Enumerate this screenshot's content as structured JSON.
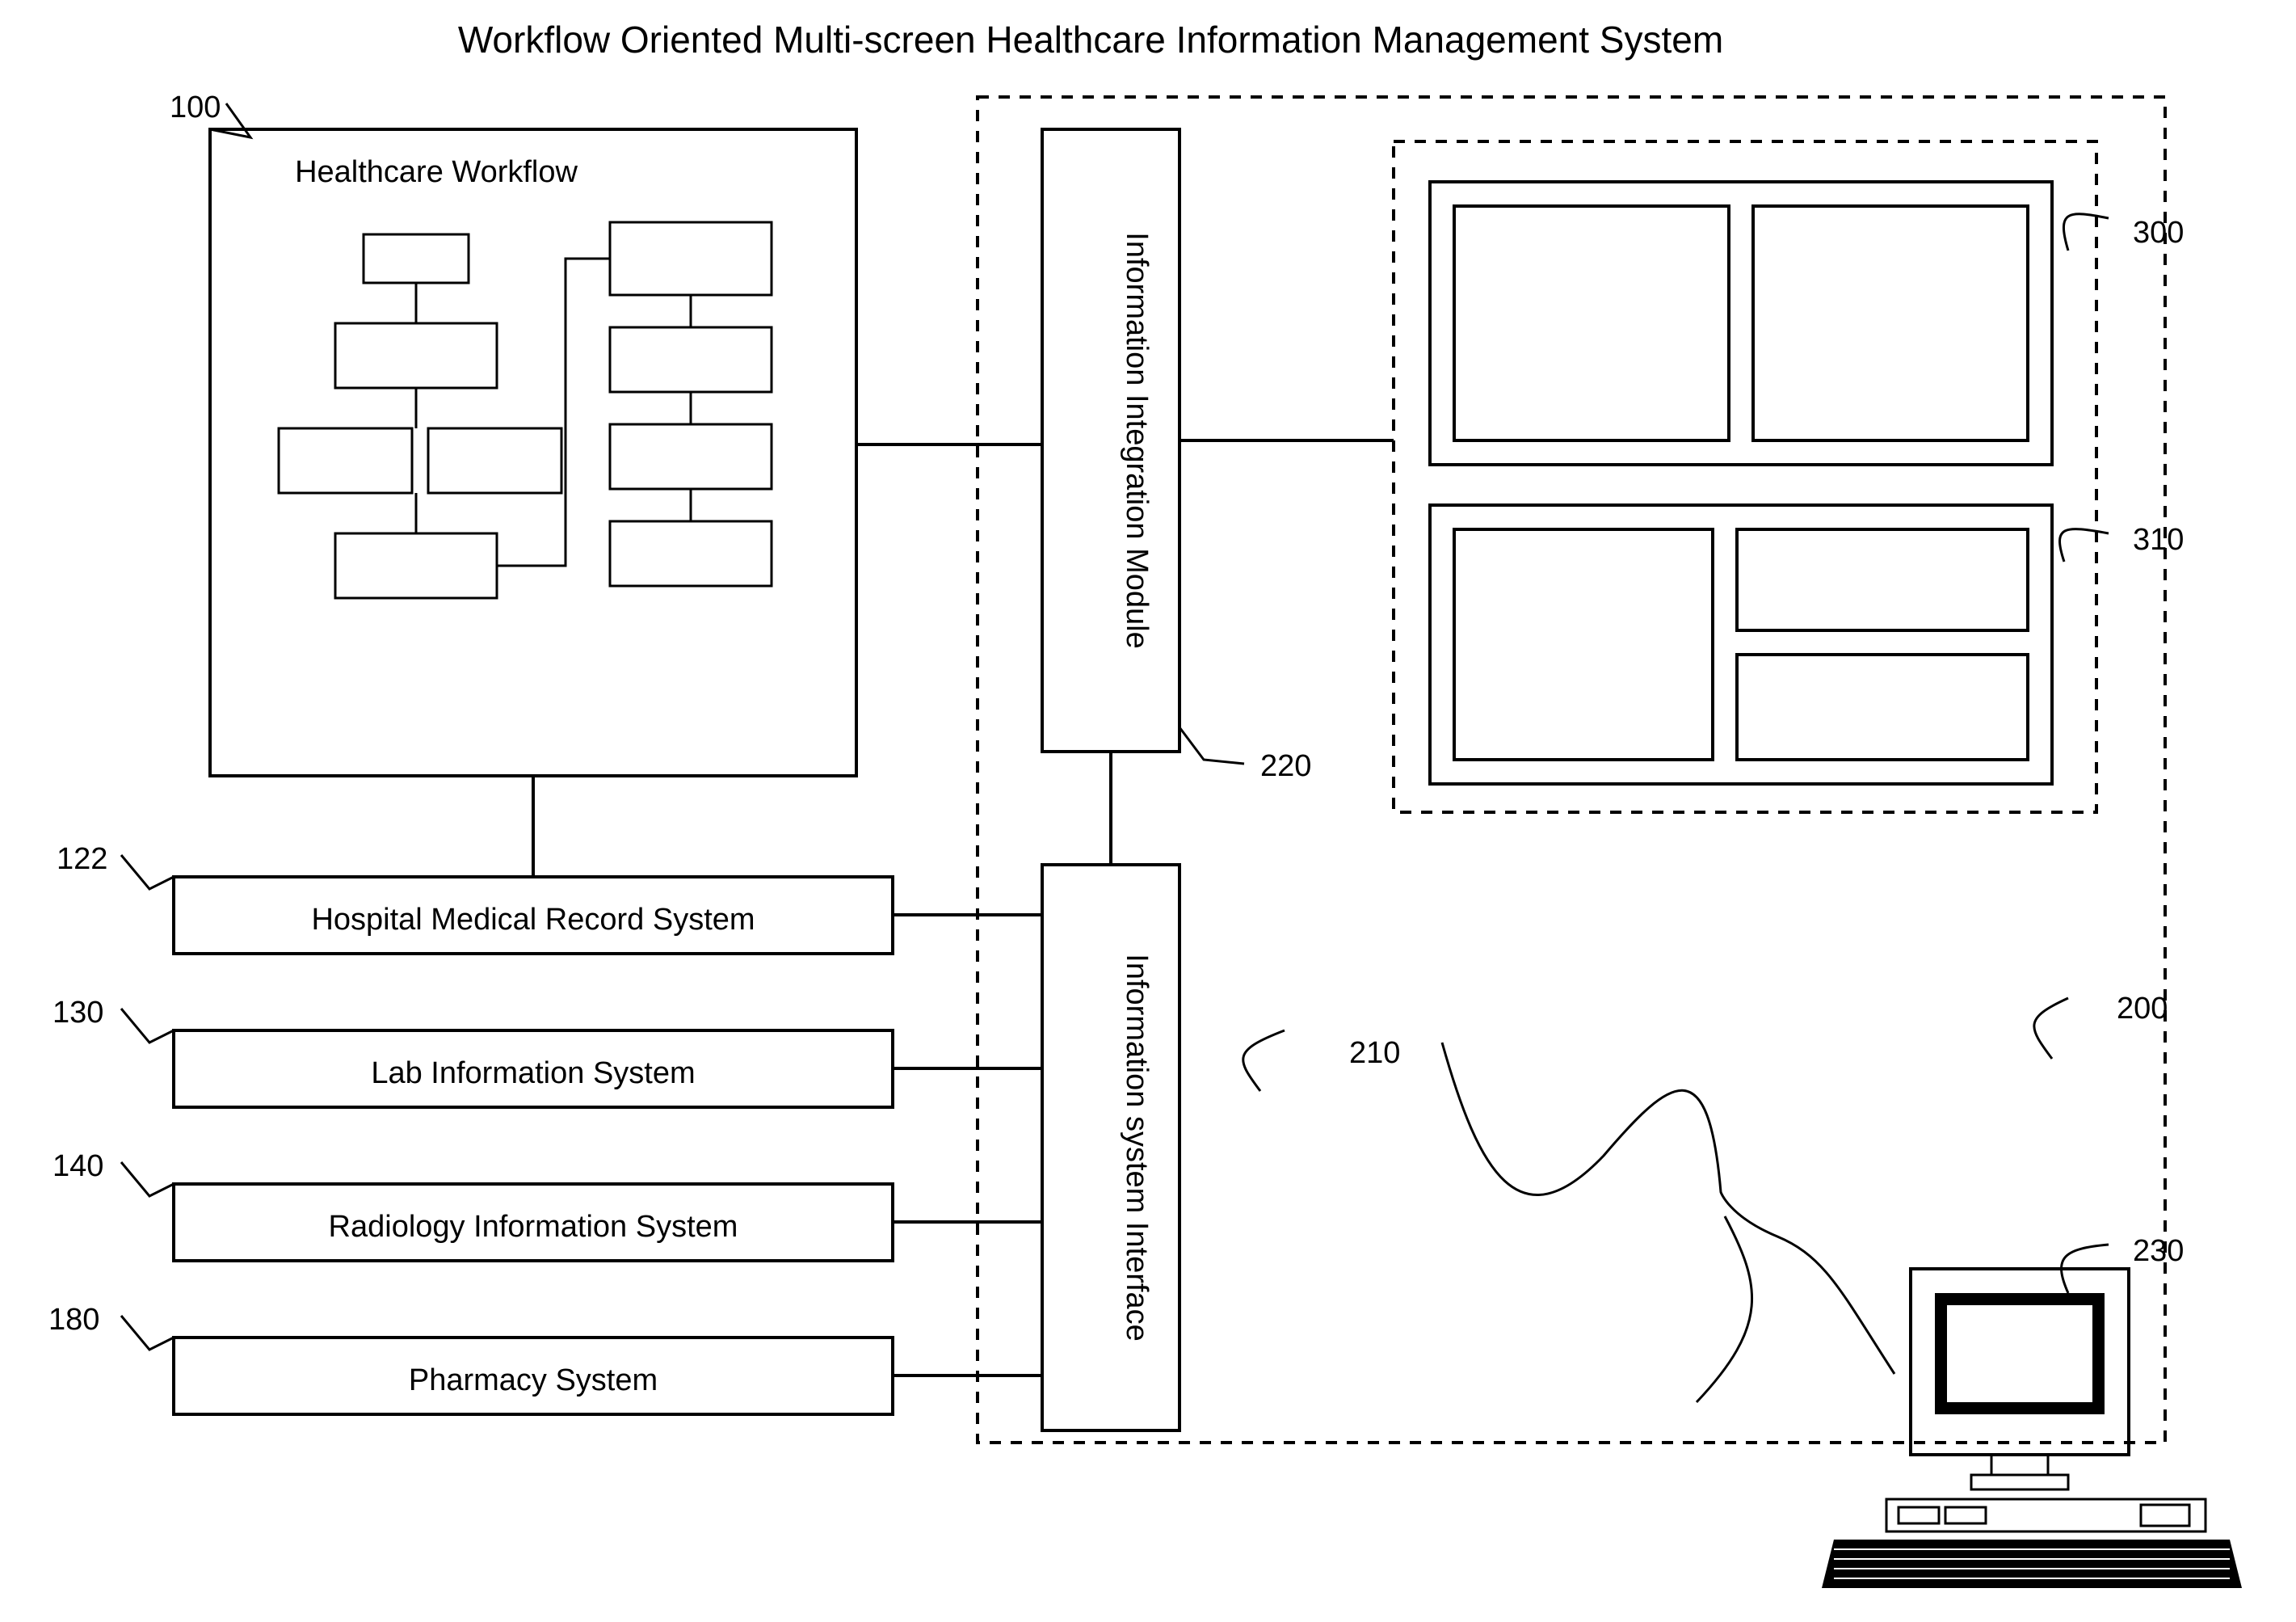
{
  "title": "Workflow Oriented Multi-screen Healthcare Information Management System",
  "blocks": {
    "workflow": "Healthcare Workflow",
    "hmrs": "Hospital Medical Record System",
    "lis": "Lab Information System",
    "ris": "Radiology Information System",
    "pharmacy": "Pharmacy System",
    "iim": "Information Integration Module",
    "isi": "Information system Interface"
  },
  "refs": {
    "r100": "100",
    "r122": "122",
    "r130": "130",
    "r140": "140",
    "r180": "180",
    "r200": "200",
    "r210": "210",
    "r220": "220",
    "r230": "230",
    "r300": "300",
    "r310": "310"
  }
}
